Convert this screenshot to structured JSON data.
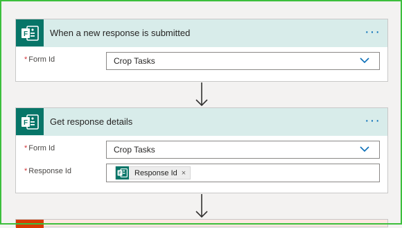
{
  "cards": [
    {
      "title": "When a new response is submitted",
      "more_label": "···",
      "fields": [
        {
          "label": "Form Id",
          "value": "Crop Tasks"
        }
      ]
    },
    {
      "title": "Get response details",
      "more_label": "···",
      "fields": [
        {
          "label": "Form Id",
          "value": "Crop Tasks"
        },
        {
          "label": "Response Id",
          "token": "Response Id",
          "token_remove": "×"
        }
      ]
    }
  ],
  "required_marker": "*",
  "icons": {
    "forms": "microsoft-forms-icon",
    "dropdown": "chevron-down-icon",
    "connector": "down-arrow-icon"
  },
  "colors": {
    "forms_tile": "#077568",
    "header_bg": "#d8ecea",
    "link_blue": "#0a6fb8",
    "required": "#d13438",
    "next_tile": "#d83b01"
  }
}
